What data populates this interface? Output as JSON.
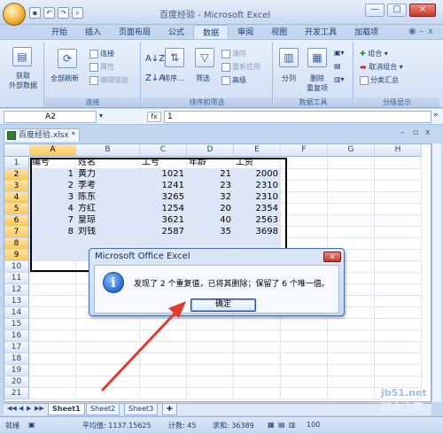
{
  "title": {
    "document": "百度经验",
    "app": "Microsoft Excel",
    "separator": " - "
  },
  "window": {
    "min": "—",
    "max": "□",
    "close": "×"
  },
  "ribbon_tabs": [
    "开始",
    "插入",
    "页面布局",
    "公式",
    "数据",
    "审阅",
    "视图",
    "开发工具",
    "加载项"
  ],
  "ribbon_active": "数据",
  "ribbon": {
    "get_external": {
      "label": "获取\n外部数据"
    },
    "refresh_all": {
      "label": "全部刷新",
      "icon": "refresh-icon"
    },
    "connections": {
      "connections": "连接",
      "properties": "属性",
      "edit_links": "编辑链接",
      "group": "连接"
    },
    "sort": {
      "sort": "排序...",
      "filter": "筛选",
      "clear": "清除",
      "reapply": "重新应用",
      "advanced": "高级",
      "group": "排序和筛选"
    },
    "tools": {
      "split": "分列",
      "remove_dup": "删除\n重复项",
      "group": "数据工具"
    },
    "outline": {
      "group_btn": "组合",
      "ungroup": "取消组合",
      "subtotal": "分类汇总",
      "group": "分级显示"
    }
  },
  "formula_bar": {
    "name_box": "A2",
    "fx": "fx",
    "content": "1"
  },
  "doc_tab": "百度经验.xlsx *",
  "columns": [
    "A",
    "B",
    "C",
    "D",
    "E",
    "F",
    "G",
    "H"
  ],
  "rows": [
    "1",
    "2",
    "3",
    "4",
    "5",
    "6",
    "7",
    "8",
    "9",
    "10",
    "11",
    "12",
    "13",
    "14",
    "15",
    "16",
    "17",
    "18",
    "19",
    "20",
    "21"
  ],
  "table": [
    [
      "编号",
      "姓名",
      "工号",
      "年龄",
      "工资"
    ],
    [
      "1",
      "黄力",
      "1021",
      "21",
      "2000"
    ],
    [
      "2",
      "李考",
      "1241",
      "23",
      "2310"
    ],
    [
      "3",
      "陈东",
      "3265",
      "32",
      "2310"
    ],
    [
      "4",
      "方红",
      "1254",
      "20",
      "2354"
    ],
    [
      "7",
      "皇琼",
      "3621",
      "40",
      "2563"
    ],
    [
      "8",
      "刘钱",
      "2587",
      "35",
      "3698"
    ]
  ],
  "sheets": [
    "Sheet1",
    "Sheet2",
    "Sheet3"
  ],
  "status": {
    "ready": "就绪",
    "average": "平均值: 1137.15625",
    "count": "计数: 45",
    "sum": "求和: 36389",
    "zoom": "100"
  },
  "dialog": {
    "title": "Microsoft Office Excel",
    "message": "发现了 2 个重复值，已将其删除；保留了 6 个唯一值。",
    "ok": "确定",
    "close": "x"
  },
  "watermark": {
    "url": "jb51.net",
    "name": "脚本之家"
  },
  "colors": {
    "accent": "#15428b",
    "arrow": "#e53b2f",
    "selected_header": "#f8c85b"
  }
}
